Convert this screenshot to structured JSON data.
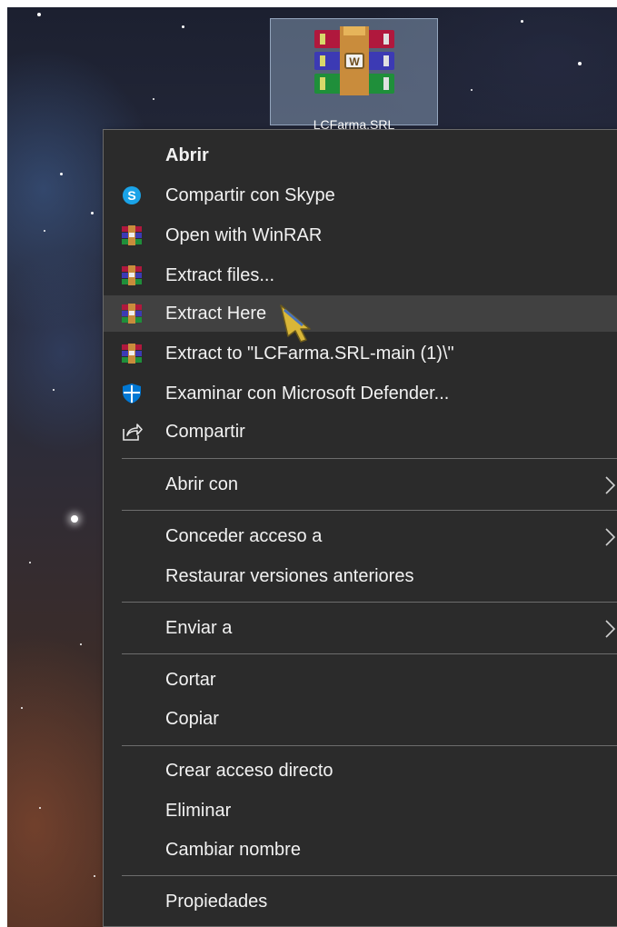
{
  "desktop_icon": {
    "label": "LCFarma.SRL",
    "icon": "winrar-archive-icon"
  },
  "context_menu": {
    "items": [
      {
        "label": "Abrir",
        "icon": null,
        "bold": true
      },
      {
        "label": "Compartir con Skype",
        "icon": "skype-icon"
      },
      {
        "label": "Open with WinRAR",
        "icon": "winrar-icon"
      },
      {
        "label": "Extract files...",
        "icon": "winrar-icon"
      },
      {
        "label": "Extract Here",
        "icon": "winrar-icon",
        "hovered": true
      },
      {
        "label": "Extract to \"LCFarma.SRL-main (1)\\\"",
        "icon": "winrar-icon"
      },
      {
        "label": "Examinar con Microsoft Defender...",
        "icon": "defender-shield-icon"
      },
      {
        "label": "Compartir",
        "icon": "share-icon"
      },
      {
        "label": "Abrir con",
        "icon": null,
        "submenu": true
      },
      {
        "label": "Conceder acceso a",
        "icon": null,
        "submenu": true
      },
      {
        "label": "Restaurar versiones anteriores",
        "icon": null
      },
      {
        "label": "Enviar a",
        "icon": null,
        "submenu": true
      },
      {
        "label": "Cortar",
        "icon": null
      },
      {
        "label": "Copiar",
        "icon": null
      },
      {
        "label": "Crear acceso directo",
        "icon": null
      },
      {
        "label": "Eliminar",
        "icon": null
      },
      {
        "label": "Cambiar nombre",
        "icon": null
      },
      {
        "label": "Propiedades",
        "icon": null
      }
    ]
  },
  "colors": {
    "menu_background": "#2b2b2b",
    "menu_hover": "#414141",
    "menu_text": "#f2f2f2",
    "separator": "#6d6d6d",
    "skype_blue": "#1aa3e8",
    "defender_blue": "#0078d4"
  }
}
